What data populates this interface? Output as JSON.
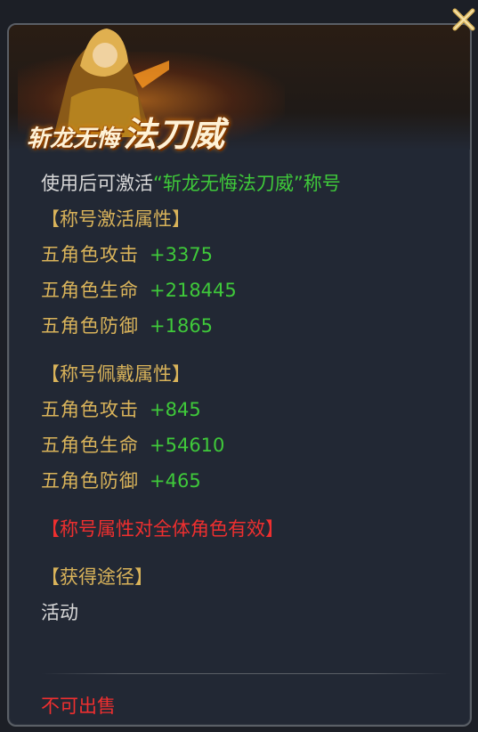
{
  "banner": {
    "title_small": "斩龙无悔",
    "title_big": "法刀威"
  },
  "intro": {
    "prefix": "使用后可激活",
    "title_quoted": "“斩龙无悔法刀威”",
    "suffix": "称号"
  },
  "activate": {
    "header": "【称号激活属性】",
    "stats": [
      {
        "label": "五角色攻击",
        "value": "+3375"
      },
      {
        "label": "五角色生命",
        "value": "+218445"
      },
      {
        "label": "五角色防御",
        "value": "+1865"
      }
    ]
  },
  "wear": {
    "header": "【称号佩戴属性】",
    "stats": [
      {
        "label": "五角色攻击",
        "value": "+845"
      },
      {
        "label": "五角色生命",
        "value": "+54610"
      },
      {
        "label": "五角色防御",
        "value": "+465"
      }
    ]
  },
  "note": "【称号属性对全体角色有效】",
  "source": {
    "header": "【获得途径】",
    "value": "活动"
  },
  "footer": {
    "not_for_sale": "不可出售"
  },
  "icons": {
    "close": "close-icon"
  }
}
